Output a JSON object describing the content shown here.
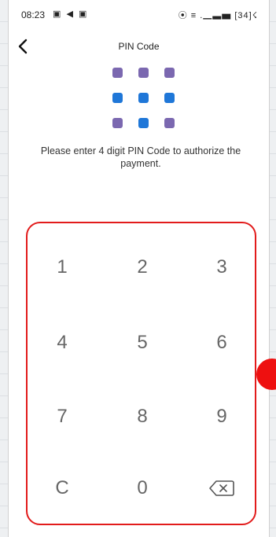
{
  "status_bar": {
    "time": "08:23",
    "left_icons": "▣ ◀ ▣",
    "right_icons": "⦿ ≡ .▁▃▅ [34]☇"
  },
  "header": {
    "title": "PIN Code"
  },
  "instruction": "Please enter 4 digit PIN Code to authorize the payment.",
  "keypad": {
    "keys": [
      "1",
      "2",
      "3",
      "4",
      "5",
      "6",
      "7",
      "8",
      "9",
      "C",
      "0"
    ]
  },
  "colors": {
    "accent": "#1f77d8",
    "dot_purple": "#7b68b0",
    "annotation_red": "#e21b1b"
  }
}
